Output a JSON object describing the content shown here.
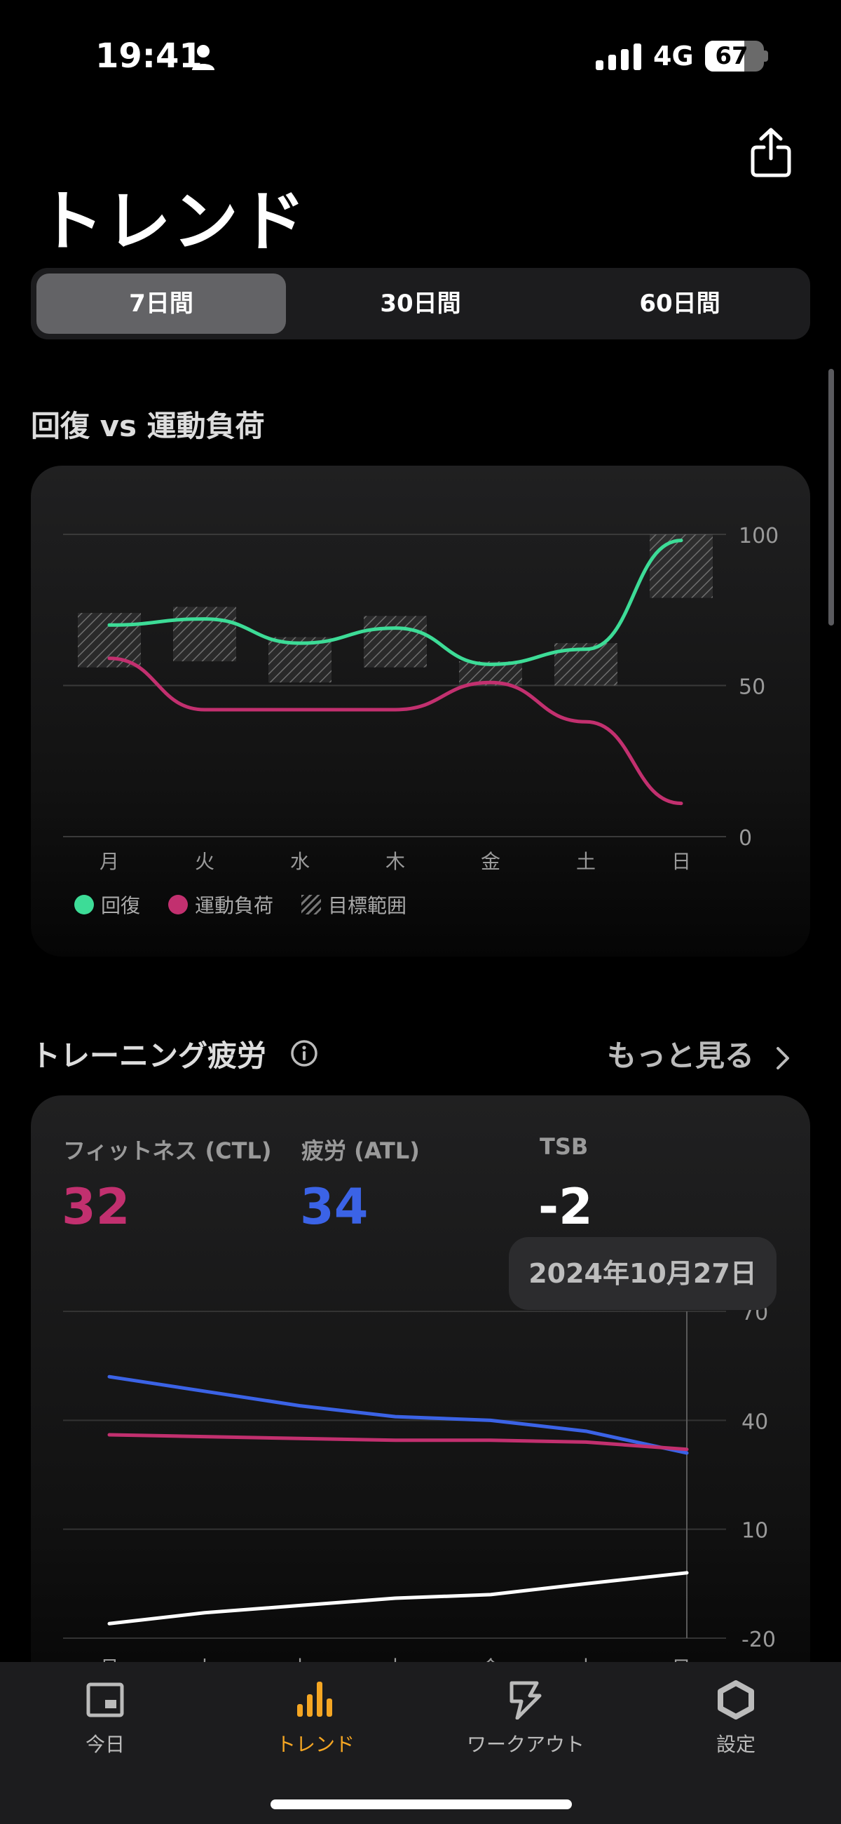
{
  "status_bar": {
    "time": "19:41",
    "network": "4G",
    "battery": "67",
    "battery_level": 0.67
  },
  "header": {
    "title": "トレンド",
    "share_icon": "share-icon"
  },
  "segments": [
    {
      "label": "7日間",
      "active": true
    },
    {
      "label": "30日間",
      "active": false
    },
    {
      "label": "60日間",
      "active": false
    }
  ],
  "recovery_section": {
    "title": "回復 vs 運動負荷",
    "legend": {
      "recovery": "回復",
      "load": "運動負荷",
      "target": "目標範囲"
    }
  },
  "fatigue_section": {
    "title": "トレーニング疲労",
    "more": "もっと見る",
    "metrics": {
      "ctl_label": "フィットネス (CTL)",
      "ctl_value": "32",
      "atl_label": "疲労 (ATL)",
      "atl_value": "34",
      "tsb_label": "TSB",
      "tsb_value": "-2"
    },
    "tooltip": "2024年10月27日"
  },
  "tabs": [
    {
      "label": "今日",
      "icon": "today-icon",
      "active": false
    },
    {
      "label": "トレンド",
      "icon": "trends-bar-icon",
      "active": true
    },
    {
      "label": "ワークアウト",
      "icon": "workout-bolt-icon",
      "active": false
    },
    {
      "label": "設定",
      "icon": "settings-hexagon-icon",
      "active": false
    }
  ],
  "colors": {
    "recovery": "#3ddc97",
    "load": "#c2306f",
    "ctl": "#c2306f",
    "atl": "#3b63e6",
    "tsb": "#ffffff",
    "accent": "#f5a623"
  },
  "chart_data": [
    {
      "type": "line",
      "x": [
        "月",
        "火",
        "水",
        "木",
        "金",
        "土",
        "日"
      ],
      "ylim": [
        0,
        100
      ],
      "yticks": [
        0,
        50,
        100
      ],
      "grid": true,
      "legend_position": "bottom-left",
      "series": [
        {
          "name": "回復",
          "values": [
            70,
            72,
            64,
            69,
            57,
            62,
            98
          ]
        },
        {
          "name": "運動負荷",
          "values": [
            59,
            42,
            42,
            42,
            51,
            38,
            11
          ]
        }
      ],
      "target_range": {
        "name": "目標範囲",
        "ranges": [
          [
            56,
            74
          ],
          [
            58,
            76
          ],
          [
            51,
            66
          ],
          [
            56,
            73
          ],
          [
            50,
            58
          ],
          [
            50,
            64
          ],
          [
            79,
            100
          ]
        ]
      }
    },
    {
      "type": "line",
      "x": [
        "月",
        "火",
        "水",
        "木",
        "金",
        "土",
        "日"
      ],
      "ylim": [
        -20,
        70
      ],
      "yticks": [
        -20,
        10,
        40,
        70
      ],
      "grid": true,
      "series": [
        {
          "name": "疲労 (ATL)",
          "values": [
            52,
            48,
            44,
            41,
            40,
            37,
            31
          ]
        },
        {
          "name": "フィットネス (CTL)",
          "values": [
            36,
            35.5,
            35,
            34.5,
            34.5,
            34,
            32
          ]
        },
        {
          "name": "TSB",
          "values": [
            -16,
            -13,
            -11,
            -9,
            -8,
            -5,
            -2
          ]
        }
      ],
      "highlighted_point": "日"
    }
  ]
}
